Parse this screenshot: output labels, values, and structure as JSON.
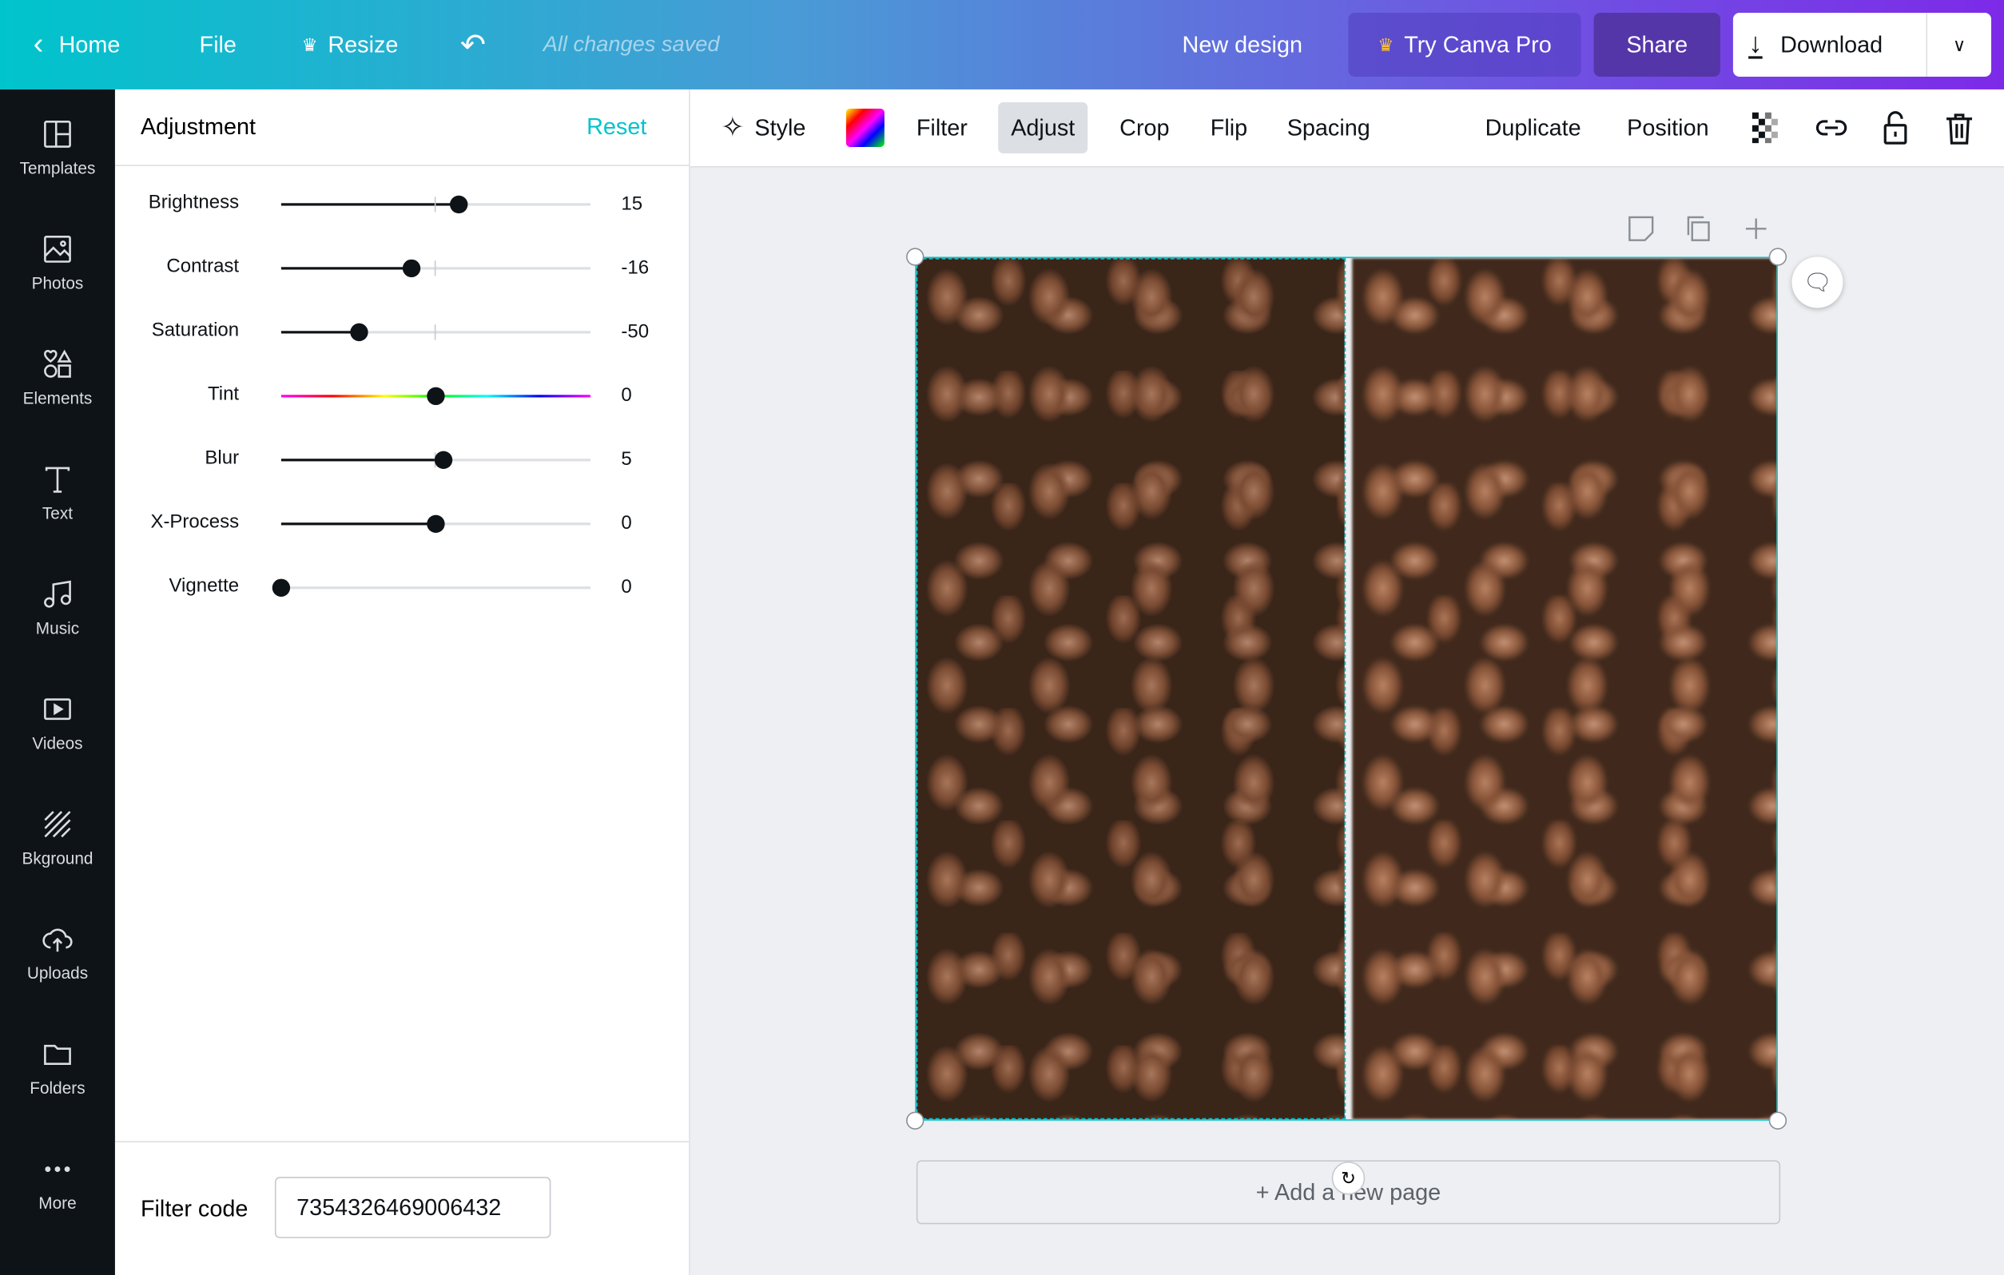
{
  "topbar": {
    "home": "Home",
    "file": "File",
    "resize": "Resize",
    "saved": "All changes saved",
    "design_name": "New design",
    "try_pro": "Try Canva Pro",
    "share": "Share",
    "download": "Download"
  },
  "sidebar": {
    "items": [
      {
        "label": "Templates",
        "icon": "templates-icon"
      },
      {
        "label": "Photos",
        "icon": "photos-icon"
      },
      {
        "label": "Elements",
        "icon": "elements-icon"
      },
      {
        "label": "Text",
        "icon": "text-icon"
      },
      {
        "label": "Music",
        "icon": "music-icon"
      },
      {
        "label": "Videos",
        "icon": "videos-icon"
      },
      {
        "label": "Bkground",
        "icon": "background-icon"
      },
      {
        "label": "Uploads",
        "icon": "uploads-icon"
      },
      {
        "label": "Folders",
        "icon": "folders-icon"
      },
      {
        "label": "More",
        "icon": "more-icon"
      }
    ]
  },
  "panel": {
    "title": "Adjustment",
    "reset": "Reset",
    "sliders": [
      {
        "label": "Brightness",
        "value": "15",
        "num": 15,
        "min": -100,
        "max": 100
      },
      {
        "label": "Contrast",
        "value": "-16",
        "num": -16,
        "min": -100,
        "max": 100
      },
      {
        "label": "Saturation",
        "value": "-50",
        "num": -50,
        "min": -100,
        "max": 100
      },
      {
        "label": "Tint",
        "value": "0",
        "num": 0,
        "min": -100,
        "max": 100
      },
      {
        "label": "Blur",
        "value": "5",
        "num": 5,
        "min": -100,
        "max": 100
      },
      {
        "label": "X-Process",
        "value": "0",
        "num": 0,
        "min": -100,
        "max": 100
      },
      {
        "label": "Vignette",
        "value": "0",
        "num": 0,
        "min": 0,
        "max": 100
      }
    ],
    "filter_code_label": "Filter code",
    "filter_code": "7354326469006432"
  },
  "toolbar": {
    "style": "Style",
    "filter": "Filter",
    "adjust": "Adjust",
    "crop": "Crop",
    "flip": "Flip",
    "spacing": "Spacing",
    "duplicate": "Duplicate",
    "position": "Position"
  },
  "canvas": {
    "add_page": "+ Add a new page"
  },
  "colors": {
    "accent": "#00c4cc",
    "sidebar": "#0e1318",
    "purple": "#7d2ae8"
  }
}
